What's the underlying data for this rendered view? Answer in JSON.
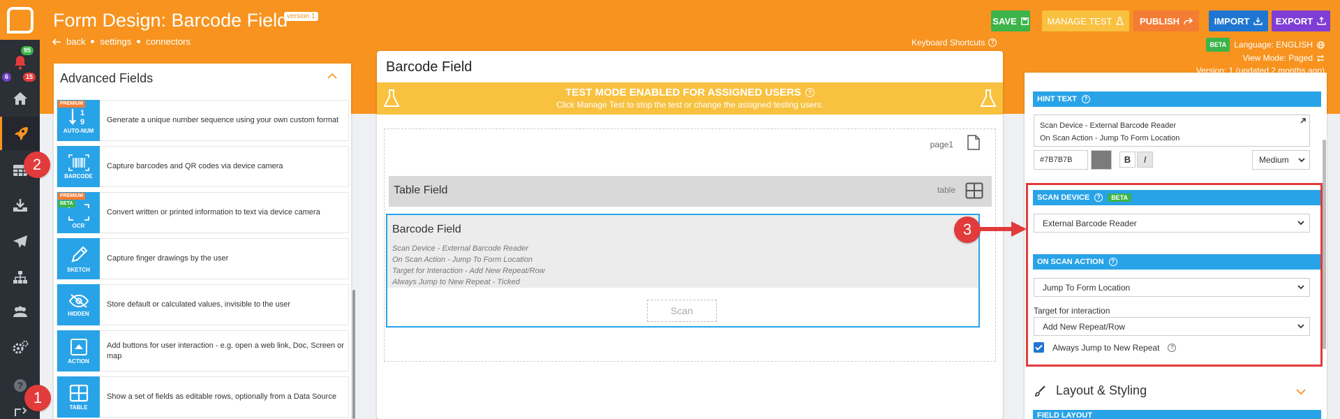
{
  "header": {
    "title": "Form Design: Barcode Field",
    "version_badge": "version 1",
    "crumbs": [
      "back",
      "settings",
      "connectors"
    ],
    "keyboard_shortcuts": "Keyboard Shortcuts",
    "buttons": {
      "save": "SAVE",
      "manage_test": "MANAGE TEST",
      "publish": "PUBLISH",
      "import": "IMPORT",
      "export": "EXPORT"
    },
    "beta": "BETA",
    "language": "Language: ENGLISH",
    "view_mode": "View Mode: Paged",
    "version_info": "Version: 1 (updated 2 months ago)"
  },
  "rail": {
    "badges": {
      "notifications": "95",
      "alerts": "6",
      "messages": "15"
    }
  },
  "left_panel": {
    "title": "Advanced Fields",
    "items": [
      {
        "icon": "autonum-icon",
        "caption": "AUTO-NUM",
        "tag": "PREMIUM",
        "desc": "Generate a unique number sequence using your own custom format"
      },
      {
        "icon": "barcode-icon",
        "caption": "BARCODE",
        "desc": "Capture barcodes and QR codes via device camera"
      },
      {
        "icon": "ocr-icon",
        "caption": "OCR",
        "tag": "PREMIUM",
        "tag2": "BETA",
        "desc": "Convert written or printed information to text via device camera"
      },
      {
        "icon": "sketch-icon",
        "caption": "SKETCH",
        "desc": "Capture finger drawings by the user"
      },
      {
        "icon": "hidden-icon",
        "caption": "HIDDEN",
        "desc": "Store default or calculated values, invisible to the user"
      },
      {
        "icon": "action-icon",
        "caption": "ACTION",
        "desc": "Add buttons for user interaction - e.g. open a web link, Doc, Screen or map"
      },
      {
        "icon": "table-icon",
        "caption": "TABLE",
        "desc": "Show a set of fields as editable rows, optionally from a Data Source"
      }
    ]
  },
  "center": {
    "title": "Barcode Field",
    "test_title": "TEST MODE ENABLED FOR ASSIGNED USERS",
    "test_sub": "Click Manage Test to stop the test or change the assigned testing users.",
    "page_label": "page1",
    "table_title": "Table Field",
    "table_tag": "table",
    "barcode_title": "Barcode Field",
    "barcode_hints": [
      "Scan Device - External Barcode Reader",
      "On Scan Action - Jump To Form Location",
      "Target for Interaction - Add New Repeat/Row",
      "Always Jump to New Repeat - Ticked"
    ],
    "scan_button": "Scan"
  },
  "right_panel": {
    "hint_text_header": "HINT TEXT",
    "hint_lines": [
      "Scan Device - External Barcode Reader",
      "On Scan Action - Jump To Form Location"
    ],
    "color_value": "#7B7B7B",
    "bold": "B",
    "italic": "I",
    "size": "Medium",
    "scan_device_header": "SCAN DEVICE",
    "scan_device_beta": "BETA",
    "scan_device_value": "External Barcode Reader",
    "on_scan_header": "ON SCAN ACTION",
    "on_scan_value": "Jump To Form Location",
    "target_label": "Target for interaction",
    "target_value": "Add New Repeat/Row",
    "always_jump_label": "Always Jump to New Repeat",
    "layout_header": "Layout & Styling",
    "field_layout_header": "FIELD LAYOUT"
  },
  "callouts": [
    "1",
    "2",
    "3"
  ],
  "colors": {
    "brand_orange": "#F7931E",
    "rail_dark": "#2B2F36",
    "accent_blue": "#29A3E8",
    "save_green": "#3CB44A",
    "manage_test_yellow": "#F8C140",
    "publish_orange": "#F47C34",
    "import_blue": "#1E76D2",
    "export_purple": "#7F3DD6",
    "callout_red": "#E23B3B"
  }
}
